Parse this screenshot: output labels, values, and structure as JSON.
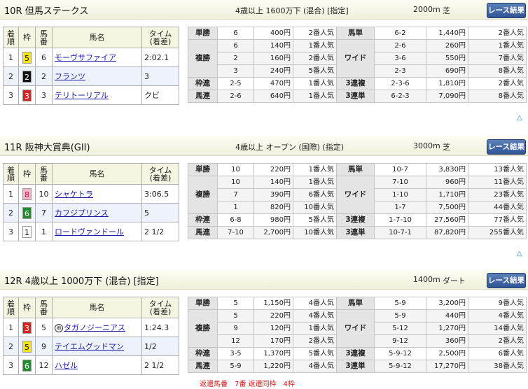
{
  "races": [
    {
      "name": "10R 但馬ステークス",
      "conditions": "4歳以上 1600万下 (混合) [指定]",
      "distance": "2000m",
      "surface": "芝",
      "results_button": "レース結果",
      "headers": {
        "place": "着\n順",
        "frame": "枠",
        "horse_no": "馬\n番",
        "horse_name": "馬名",
        "time": "タイム\n(着差)"
      },
      "rows": [
        {
          "place": "1",
          "frame": "5",
          "frame_bg": "#f5e800",
          "frame_fg": "#111",
          "horse_no": "6",
          "horse": "モーヴサファイア",
          "time": "2:02.1",
          "mark": ""
        },
        {
          "place": "2",
          "frame": "2",
          "frame_bg": "#111111",
          "frame_fg": "#fff",
          "horse_no": "2",
          "horse": "フランツ",
          "time": "3",
          "mark": ""
        },
        {
          "place": "3",
          "frame": "3",
          "frame_bg": "#e02020",
          "frame_fg": "#fff",
          "horse_no": "3",
          "horse": "テリトーリアル",
          "time": "クビ",
          "mark": ""
        }
      ],
      "odds": {
        "tansho": {
          "label": "単勝",
          "rows": [
            {
              "no": "6",
              "pay": "400円",
              "pop": "2番人気"
            }
          ]
        },
        "fukusho": {
          "label": "複勝",
          "rows": [
            {
              "no": "6",
              "pay": "140円",
              "pop": "1番人気"
            },
            {
              "no": "2",
              "pay": "160円",
              "pop": "2番人気"
            },
            {
              "no": "3",
              "pay": "240円",
              "pop": "5番人気"
            }
          ]
        },
        "wakuren": {
          "label": "枠連",
          "rows": [
            {
              "no": "2-5",
              "pay": "470円",
              "pop": "1番人気"
            }
          ]
        },
        "umaren": {
          "label": "馬連",
          "rows": [
            {
              "no": "2-6",
              "pay": "640円",
              "pop": "1番人気"
            }
          ]
        },
        "umatan": {
          "label": "馬単",
          "rows": [
            {
              "no": "6-2",
              "pay": "1,440円",
              "pop": "2番人気"
            }
          ]
        },
        "wide": {
          "label": "ワイド",
          "rows": [
            {
              "no": "2-6",
              "pay": "260円",
              "pop": "1番人気"
            },
            {
              "no": "3-6",
              "pay": "550円",
              "pop": "7番人気"
            },
            {
              "no": "2-3",
              "pay": "690円",
              "pop": "8番人気"
            }
          ]
        },
        "sanrenpuku": {
          "label": "3連複",
          "rows": [
            {
              "no": "2-3-6",
              "pay": "1,810円",
              "pop": "2番人気"
            }
          ]
        },
        "sanrentan": {
          "label": "3連単",
          "rows": [
            {
              "no": "6-2-3",
              "pay": "7,090円",
              "pop": "8番人気"
            }
          ]
        }
      }
    },
    {
      "name": "11R 阪神大賞典(GII)",
      "conditions": "4歳以上 オープン (国際) (指定)",
      "distance": "3000m",
      "surface": "芝",
      "results_button": "レース結果",
      "headers": {
        "place": "着\n順",
        "frame": "枠",
        "horse_no": "馬\n番",
        "horse_name": "馬名",
        "time": "タイム\n(着差)"
      },
      "rows": [
        {
          "place": "1",
          "frame": "8",
          "frame_bg": "#f4b6c8",
          "frame_fg": "#c01050",
          "horse_no": "10",
          "horse": "シャケトラ",
          "time": "3:06.5",
          "mark": ""
        },
        {
          "place": "2",
          "frame": "6",
          "frame_bg": "#1c8c2c",
          "frame_fg": "#fff",
          "horse_no": "7",
          "horse": "カフジプリンス",
          "time": "5",
          "mark": ""
        },
        {
          "place": "3",
          "frame": "1",
          "frame_bg": "#ffffff",
          "frame_fg": "#111",
          "horse_no": "1",
          "horse": "ロードヴァンドール",
          "time": "2 1/2",
          "mark": ""
        }
      ],
      "odds": {
        "tansho": {
          "label": "単勝",
          "rows": [
            {
              "no": "10",
              "pay": "220円",
              "pop": "1番人気"
            }
          ]
        },
        "fukusho": {
          "label": "複勝",
          "rows": [
            {
              "no": "10",
              "pay": "140円",
              "pop": "1番人気"
            },
            {
              "no": "7",
              "pay": "390円",
              "pop": "6番人気"
            },
            {
              "no": "1",
              "pay": "820円",
              "pop": "10番人気"
            }
          ]
        },
        "wakuren": {
          "label": "枠連",
          "rows": [
            {
              "no": "6-8",
              "pay": "980円",
              "pop": "5番人気"
            }
          ]
        },
        "umaren": {
          "label": "馬連",
          "rows": [
            {
              "no": "7-10",
              "pay": "2,700円",
              "pop": "10番人気"
            }
          ]
        },
        "umatan": {
          "label": "馬単",
          "rows": [
            {
              "no": "10-7",
              "pay": "3,830円",
              "pop": "13番人気"
            }
          ]
        },
        "wide": {
          "label": "ワイド",
          "rows": [
            {
              "no": "7-10",
              "pay": "960円",
              "pop": "11番人気"
            },
            {
              "no": "1-10",
              "pay": "1,710円",
              "pop": "23番人気"
            },
            {
              "no": "1-7",
              "pay": "7,500円",
              "pop": "44番人気"
            }
          ]
        },
        "sanrenpuku": {
          "label": "3連複",
          "rows": [
            {
              "no": "1-7-10",
              "pay": "27,560円",
              "pop": "77番人気"
            }
          ]
        },
        "sanrentan": {
          "label": "3連単",
          "rows": [
            {
              "no": "10-7-1",
              "pay": "87,820円",
              "pop": "255番人気"
            }
          ]
        }
      }
    },
    {
      "name": "12R 4歳以上 1000万下 (混合) [指定]",
      "conditions": "",
      "distance": "1400m",
      "surface": "ダート",
      "results_button": "レース結果",
      "headers": {
        "place": "着\n順",
        "frame": "枠",
        "horse_no": "馬\n番",
        "horse_name": "馬名",
        "time": "タイム\n(着差)"
      },
      "rows": [
        {
          "place": "1",
          "frame": "3",
          "frame_bg": "#e02020",
          "frame_fg": "#fff",
          "horse_no": "5",
          "horse": "タガノジーニアス",
          "time": "1:24.3",
          "mark": "地"
        },
        {
          "place": "2",
          "frame": "5",
          "frame_bg": "#f5e800",
          "frame_fg": "#111",
          "horse_no": "9",
          "horse": "テイエムグッドマン",
          "time": "1/2",
          "mark": ""
        },
        {
          "place": "3",
          "frame": "6",
          "frame_bg": "#1c8c2c",
          "frame_fg": "#fff",
          "horse_no": "12",
          "horse": "ハゼル",
          "time": "2 1/2",
          "mark": ""
        }
      ],
      "odds": {
        "tansho": {
          "label": "単勝",
          "rows": [
            {
              "no": "5",
              "pay": "1,150円",
              "pop": "4番人気"
            }
          ]
        },
        "fukusho": {
          "label": "複勝",
          "rows": [
            {
              "no": "5",
              "pay": "220円",
              "pop": "4番人気"
            },
            {
              "no": "9",
              "pay": "120円",
              "pop": "1番人気"
            },
            {
              "no": "12",
              "pay": "170円",
              "pop": "2番人気"
            }
          ]
        },
        "wakuren": {
          "label": "枠連",
          "rows": [
            {
              "no": "3-5",
              "pay": "1,370円",
              "pop": "5番人気"
            }
          ]
        },
        "umaren": {
          "label": "馬連",
          "rows": [
            {
              "no": "5-9",
              "pay": "1,220円",
              "pop": "4番人気"
            }
          ]
        },
        "umatan": {
          "label": "馬単",
          "rows": [
            {
              "no": "5-9",
              "pay": "3,200円",
              "pop": "9番人気"
            }
          ]
        },
        "wide": {
          "label": "ワイド",
          "rows": [
            {
              "no": "5-9",
              "pay": "440円",
              "pop": "4番人気"
            },
            {
              "no": "5-12",
              "pay": "1,270円",
              "pop": "14番人気"
            },
            {
              "no": "9-12",
              "pay": "360円",
              "pop": "2番人気"
            }
          ]
        },
        "sanrenpuku": {
          "label": "3連複",
          "rows": [
            {
              "no": "5-9-12",
              "pay": "2,500円",
              "pop": "6番人気"
            }
          ]
        },
        "sanrentan": {
          "label": "3連単",
          "rows": [
            {
              "no": "5-9-12",
              "pay": "17,270円",
              "pop": "38番人気"
            }
          ]
        }
      },
      "refund": "返還馬番　7番 返還同枠　4枠"
    }
  ],
  "back_to_top_icon": "triangle-up-icon",
  "back_to_top_glyph": "△"
}
